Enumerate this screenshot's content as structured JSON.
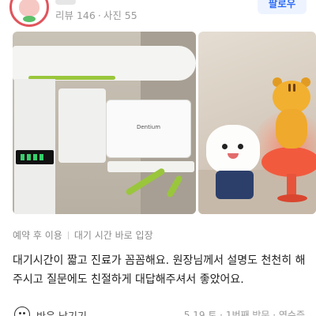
{
  "profile": {
    "avatar_icon": "tooth-character-avatar",
    "meta_reviews": "리뷰 146",
    "meta_separator": "·",
    "meta_photos": "사진 55",
    "follow_label": "팔로우"
  },
  "photos": [
    {
      "name": "dental-xray-machine-photo",
      "brand_text": "Dentium"
    },
    {
      "name": "tooth-and-tiger-toy-photo"
    }
  ],
  "tags": [
    "예약 후 이용",
    "대기 시간 바로 입장"
  ],
  "review_text": "대기시간이 짧고 진료가 꼼꼼해요. 원장님께서 설명도 천천히 해주시고 질문에도 친절하게 대답해주셔서 좋았어요.",
  "footer": {
    "reaction_icon": "smile-icon",
    "reaction_label": "반응 남기기",
    "visit_info": "5.19.토 · 1번째 방문 · 영수증"
  },
  "colors": {
    "accent_blue": "#2f6df6",
    "follow_bg": "#eef4ff",
    "avatar_ring": "#e1545c"
  }
}
